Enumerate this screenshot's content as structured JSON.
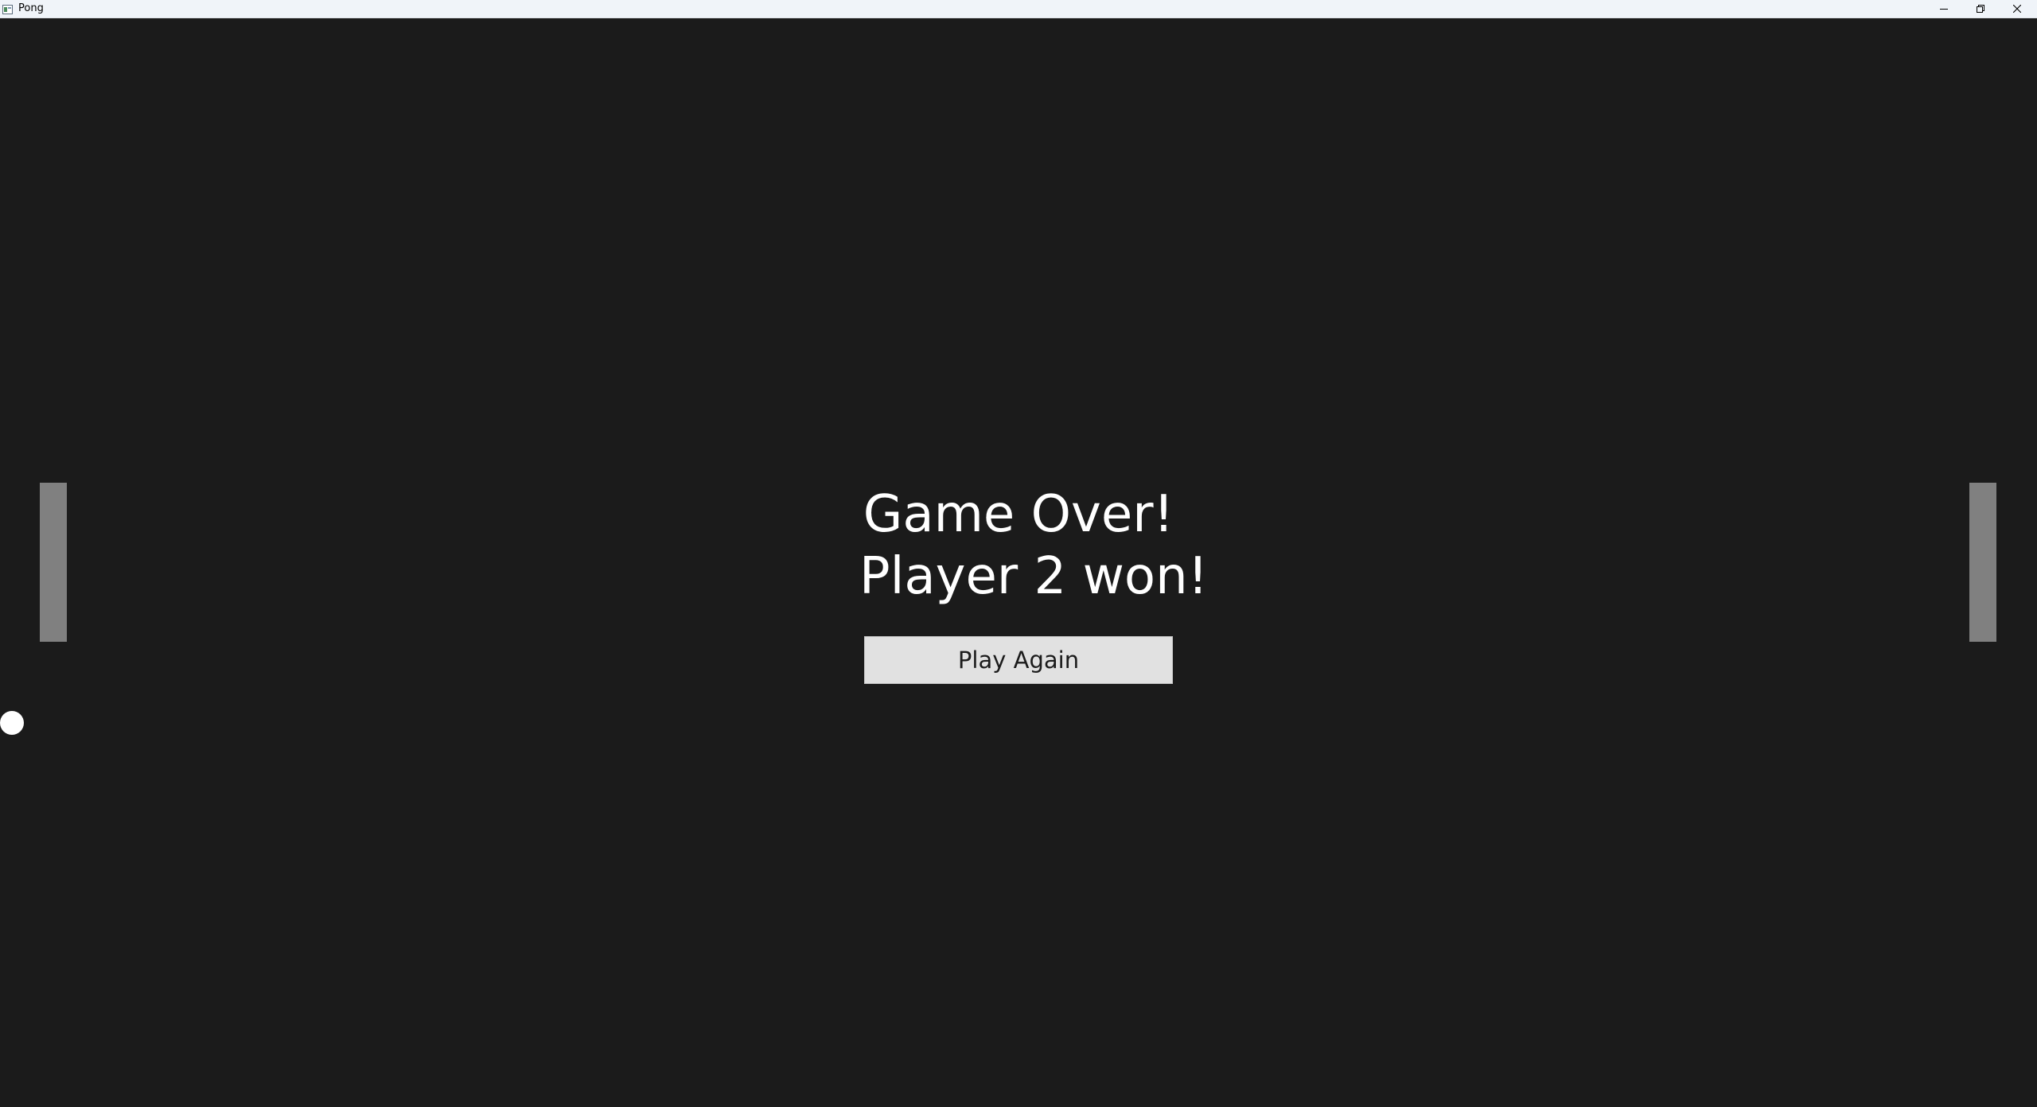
{
  "window": {
    "title": "Pong",
    "controls": {
      "minimize_icon": "minimize-icon",
      "maximize_icon": "restore-icon",
      "close_icon": "close-icon"
    }
  },
  "game": {
    "background_color": "#1b1b1b",
    "paddle_color": "#808080",
    "ball_color": "#ffffff",
    "message": {
      "line1": "Game Over!",
      "line2": "Player 2 won!"
    },
    "play_again_label": "Play Again"
  }
}
